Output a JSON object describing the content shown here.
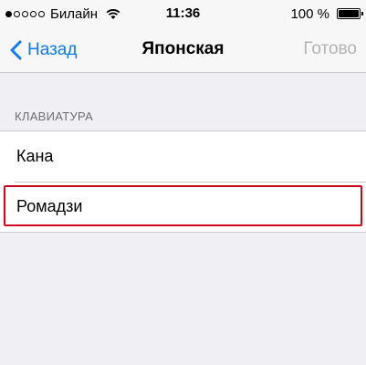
{
  "status_bar": {
    "carrier": "Билайн",
    "time": "11:36",
    "battery": "100 %",
    "signal_bars_filled": 1
  },
  "nav": {
    "back_label": "Назад",
    "title": "Японская",
    "done_label": "Готово"
  },
  "section": {
    "header": "КЛАВИАТУРА",
    "items": [
      {
        "label": "Кана"
      },
      {
        "label": "Ромадзи"
      }
    ]
  },
  "colors": {
    "accent": "#0a7aff",
    "highlight": "#d0021b",
    "background": "#efeff4"
  }
}
